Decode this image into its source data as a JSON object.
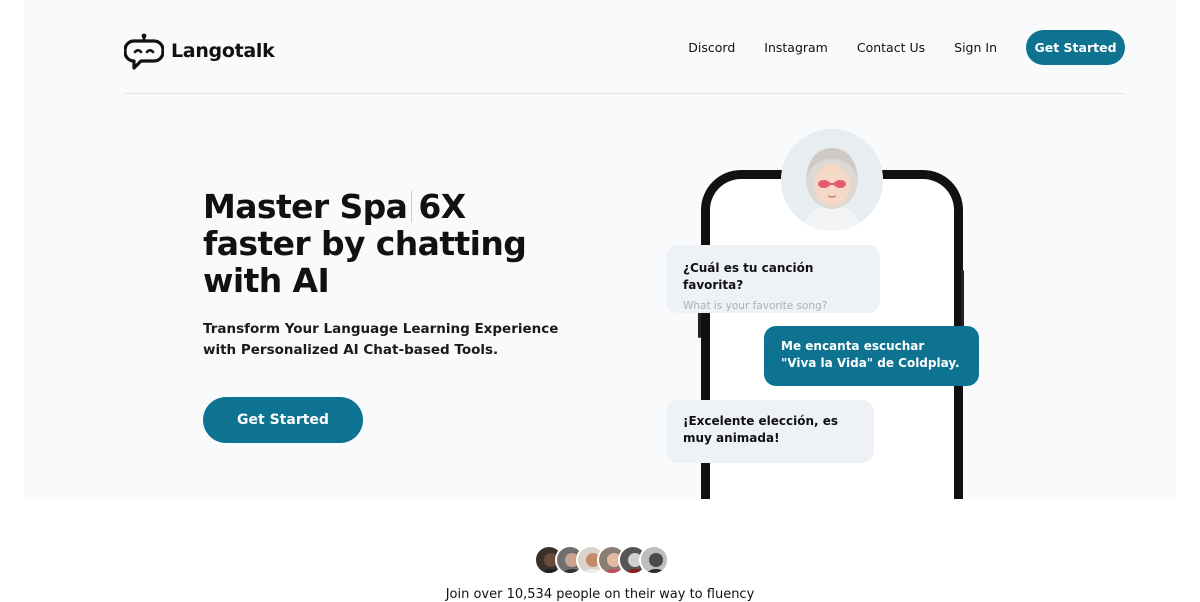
{
  "brand": {
    "name": "Langotalk",
    "logo_icon": "chat-robot-logo-icon",
    "accent": "#0e7390"
  },
  "nav": {
    "items": [
      "Discord",
      "Instagram",
      "Contact Us",
      "Sign In"
    ],
    "cta": "Get Started"
  },
  "hero": {
    "headline_part1": "Master Spa",
    "headline_part2": "6X faster by chatting with AI",
    "subtitle": "Transform Your Language Learning Experience with Personalized AI Chat-based Tools.",
    "cta": "Get Started"
  },
  "chat": {
    "messages": [
      {
        "text": "¿Cuál es tu canción favorita?",
        "translation": "What is your favorite song?"
      },
      {
        "text": "Me encanta escuchar \"Viva la Vida\" de Coldplay."
      },
      {
        "text": "¡Excelente elección, es muy animada!"
      }
    ]
  },
  "social_proof": {
    "text": "Join over 10,534 people on their way to fluency"
  }
}
